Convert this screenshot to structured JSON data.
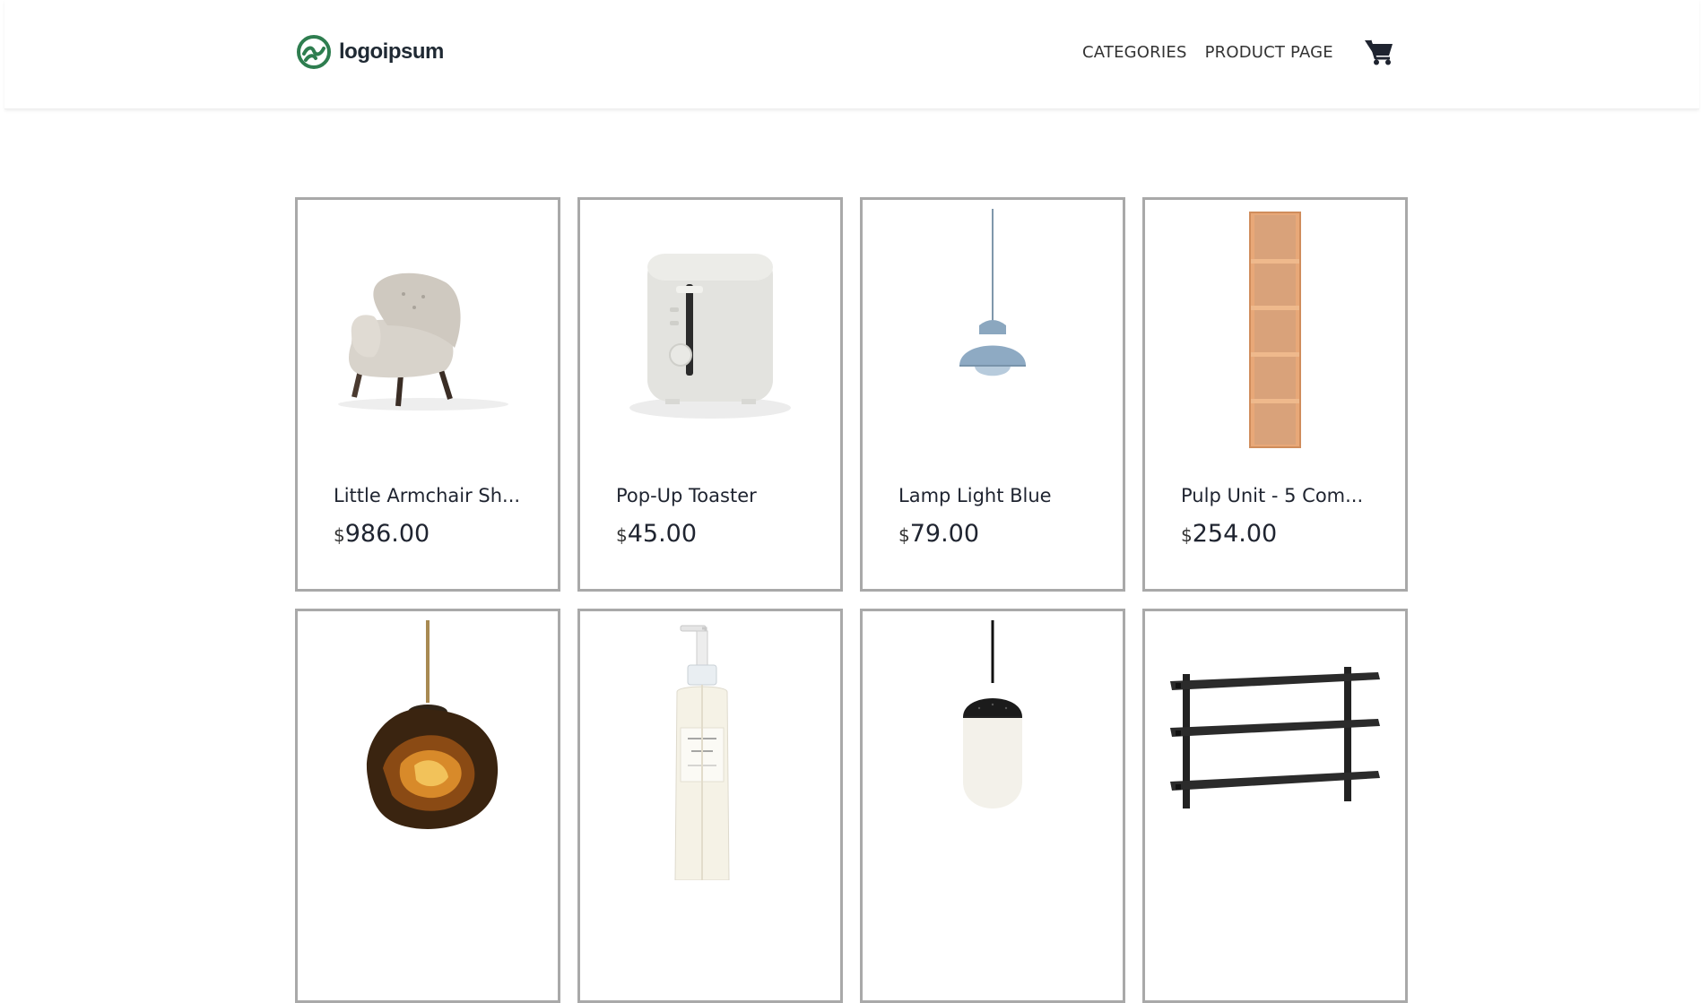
{
  "brand": {
    "name": "logoipsum",
    "color": "#2e7d4f"
  },
  "nav": {
    "categories": "CATEGORIES",
    "product_page": "PRODUCT PAGE"
  },
  "cart": {
    "icon": "shopping-cart-icon"
  },
  "products": [
    {
      "name": "Little Armchair Sh...",
      "currency": "$",
      "price": "986.00",
      "image": "armchair"
    },
    {
      "name": "Pop-Up Toaster",
      "currency": "$",
      "price": "45.00",
      "image": "toaster"
    },
    {
      "name": "Lamp Light Blue",
      "currency": "$",
      "price": "79.00",
      "image": "pendant-lamp-blue"
    },
    {
      "name": "Pulp Unit - 5 Com...",
      "currency": "$",
      "price": "254.00",
      "image": "bookshelf"
    },
    {
      "name": "",
      "currency": "",
      "price": "",
      "image": "copper-pendant"
    },
    {
      "name": "",
      "currency": "",
      "price": "",
      "image": "cleansing-oil-bottle"
    },
    {
      "name": "",
      "currency": "",
      "price": "",
      "image": "black-pendant"
    },
    {
      "name": "",
      "currency": "",
      "price": "",
      "image": "wall-shelf"
    }
  ]
}
